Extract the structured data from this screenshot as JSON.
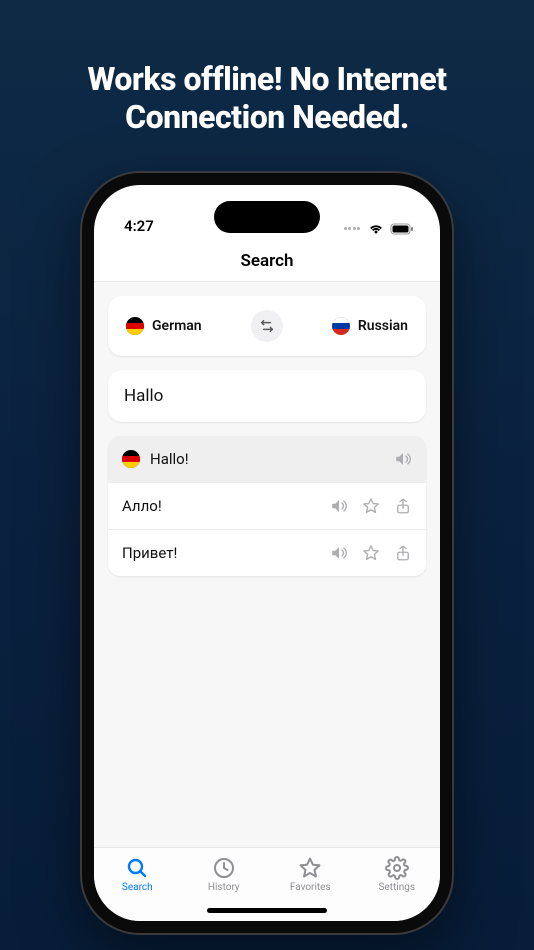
{
  "headline": "Works offline! No Internet Connection Needed.",
  "status": {
    "time": "4:27"
  },
  "nav": {
    "title": "Search"
  },
  "lang": {
    "source": "German",
    "target": "Russian"
  },
  "search": {
    "value": "Hallo"
  },
  "results": {
    "header": "Hallo!",
    "items": [
      {
        "text": "Алло!"
      },
      {
        "text": "Привет!"
      }
    ]
  },
  "tabs": {
    "search": "Search",
    "history": "History",
    "favorites": "Favorites",
    "settings": "Settings"
  }
}
